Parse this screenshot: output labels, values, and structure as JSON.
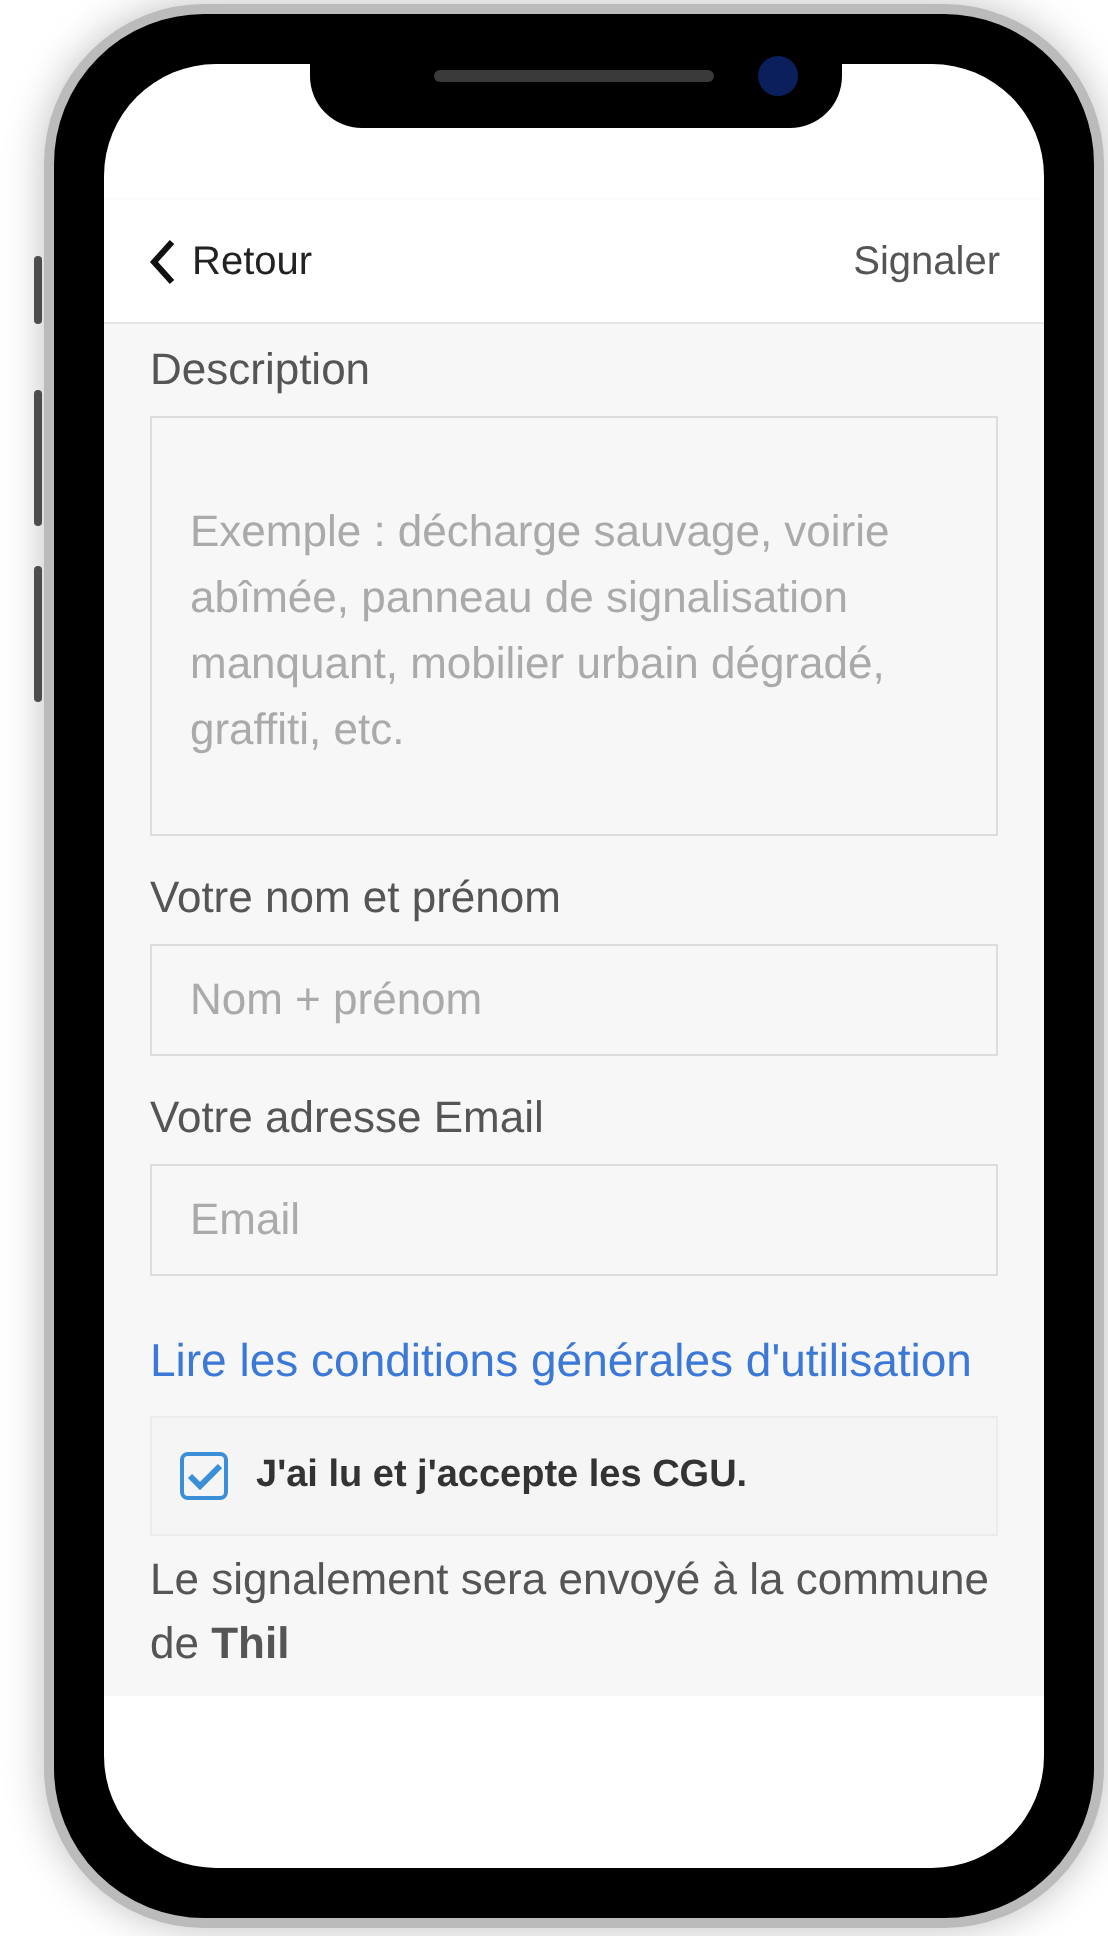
{
  "nav": {
    "back_label": "Retour",
    "action": "Signaler"
  },
  "fields": [
    {
      "kind": "textarea",
      "label": "Description",
      "placeholder": "Exemple : décharge sauvage, voirie abîmée, panneau de signalisation manquant, mobilier urbain dégradé, graffiti, etc."
    },
    {
      "kind": "input",
      "label": "Votre nom et prénom",
      "placeholder": "Nom + prénom"
    },
    {
      "kind": "input",
      "label": "Votre adresse Email",
      "placeholder": "Email"
    }
  ],
  "cgu_link": "Lire les conditions générales d'utilisation",
  "consent": {
    "label": "J'ai lu et j'accepte les CGU.",
    "checked": true
  },
  "notice": "Le signalement sera envoyé à la commune de **Thil**"
}
